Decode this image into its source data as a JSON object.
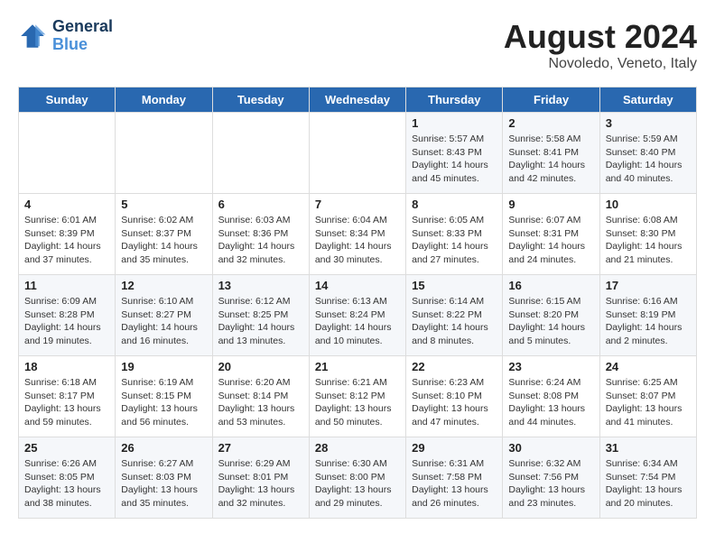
{
  "header": {
    "logo_line1": "General",
    "logo_line2": "Blue",
    "main_title": "August 2024",
    "subtitle": "Novoledo, Veneto, Italy"
  },
  "weekdays": [
    "Sunday",
    "Monday",
    "Tuesday",
    "Wednesday",
    "Thursday",
    "Friday",
    "Saturday"
  ],
  "weeks": [
    [
      {
        "day": "",
        "info": ""
      },
      {
        "day": "",
        "info": ""
      },
      {
        "day": "",
        "info": ""
      },
      {
        "day": "",
        "info": ""
      },
      {
        "day": "1",
        "info": "Sunrise: 5:57 AM\nSunset: 8:43 PM\nDaylight: 14 hours and 45 minutes."
      },
      {
        "day": "2",
        "info": "Sunrise: 5:58 AM\nSunset: 8:41 PM\nDaylight: 14 hours and 42 minutes."
      },
      {
        "day": "3",
        "info": "Sunrise: 5:59 AM\nSunset: 8:40 PM\nDaylight: 14 hours and 40 minutes."
      }
    ],
    [
      {
        "day": "4",
        "info": "Sunrise: 6:01 AM\nSunset: 8:39 PM\nDaylight: 14 hours and 37 minutes."
      },
      {
        "day": "5",
        "info": "Sunrise: 6:02 AM\nSunset: 8:37 PM\nDaylight: 14 hours and 35 minutes."
      },
      {
        "day": "6",
        "info": "Sunrise: 6:03 AM\nSunset: 8:36 PM\nDaylight: 14 hours and 32 minutes."
      },
      {
        "day": "7",
        "info": "Sunrise: 6:04 AM\nSunset: 8:34 PM\nDaylight: 14 hours and 30 minutes."
      },
      {
        "day": "8",
        "info": "Sunrise: 6:05 AM\nSunset: 8:33 PM\nDaylight: 14 hours and 27 minutes."
      },
      {
        "day": "9",
        "info": "Sunrise: 6:07 AM\nSunset: 8:31 PM\nDaylight: 14 hours and 24 minutes."
      },
      {
        "day": "10",
        "info": "Sunrise: 6:08 AM\nSunset: 8:30 PM\nDaylight: 14 hours and 21 minutes."
      }
    ],
    [
      {
        "day": "11",
        "info": "Sunrise: 6:09 AM\nSunset: 8:28 PM\nDaylight: 14 hours and 19 minutes."
      },
      {
        "day": "12",
        "info": "Sunrise: 6:10 AM\nSunset: 8:27 PM\nDaylight: 14 hours and 16 minutes."
      },
      {
        "day": "13",
        "info": "Sunrise: 6:12 AM\nSunset: 8:25 PM\nDaylight: 14 hours and 13 minutes."
      },
      {
        "day": "14",
        "info": "Sunrise: 6:13 AM\nSunset: 8:24 PM\nDaylight: 14 hours and 10 minutes."
      },
      {
        "day": "15",
        "info": "Sunrise: 6:14 AM\nSunset: 8:22 PM\nDaylight: 14 hours and 8 minutes."
      },
      {
        "day": "16",
        "info": "Sunrise: 6:15 AM\nSunset: 8:20 PM\nDaylight: 14 hours and 5 minutes."
      },
      {
        "day": "17",
        "info": "Sunrise: 6:16 AM\nSunset: 8:19 PM\nDaylight: 14 hours and 2 minutes."
      }
    ],
    [
      {
        "day": "18",
        "info": "Sunrise: 6:18 AM\nSunset: 8:17 PM\nDaylight: 13 hours and 59 minutes."
      },
      {
        "day": "19",
        "info": "Sunrise: 6:19 AM\nSunset: 8:15 PM\nDaylight: 13 hours and 56 minutes."
      },
      {
        "day": "20",
        "info": "Sunrise: 6:20 AM\nSunset: 8:14 PM\nDaylight: 13 hours and 53 minutes."
      },
      {
        "day": "21",
        "info": "Sunrise: 6:21 AM\nSunset: 8:12 PM\nDaylight: 13 hours and 50 minutes."
      },
      {
        "day": "22",
        "info": "Sunrise: 6:23 AM\nSunset: 8:10 PM\nDaylight: 13 hours and 47 minutes."
      },
      {
        "day": "23",
        "info": "Sunrise: 6:24 AM\nSunset: 8:08 PM\nDaylight: 13 hours and 44 minutes."
      },
      {
        "day": "24",
        "info": "Sunrise: 6:25 AM\nSunset: 8:07 PM\nDaylight: 13 hours and 41 minutes."
      }
    ],
    [
      {
        "day": "25",
        "info": "Sunrise: 6:26 AM\nSunset: 8:05 PM\nDaylight: 13 hours and 38 minutes."
      },
      {
        "day": "26",
        "info": "Sunrise: 6:27 AM\nSunset: 8:03 PM\nDaylight: 13 hours and 35 minutes."
      },
      {
        "day": "27",
        "info": "Sunrise: 6:29 AM\nSunset: 8:01 PM\nDaylight: 13 hours and 32 minutes."
      },
      {
        "day": "28",
        "info": "Sunrise: 6:30 AM\nSunset: 8:00 PM\nDaylight: 13 hours and 29 minutes."
      },
      {
        "day": "29",
        "info": "Sunrise: 6:31 AM\nSunset: 7:58 PM\nDaylight: 13 hours and 26 minutes."
      },
      {
        "day": "30",
        "info": "Sunrise: 6:32 AM\nSunset: 7:56 PM\nDaylight: 13 hours and 23 minutes."
      },
      {
        "day": "31",
        "info": "Sunrise: 6:34 AM\nSunset: 7:54 PM\nDaylight: 13 hours and 20 minutes."
      }
    ]
  ]
}
